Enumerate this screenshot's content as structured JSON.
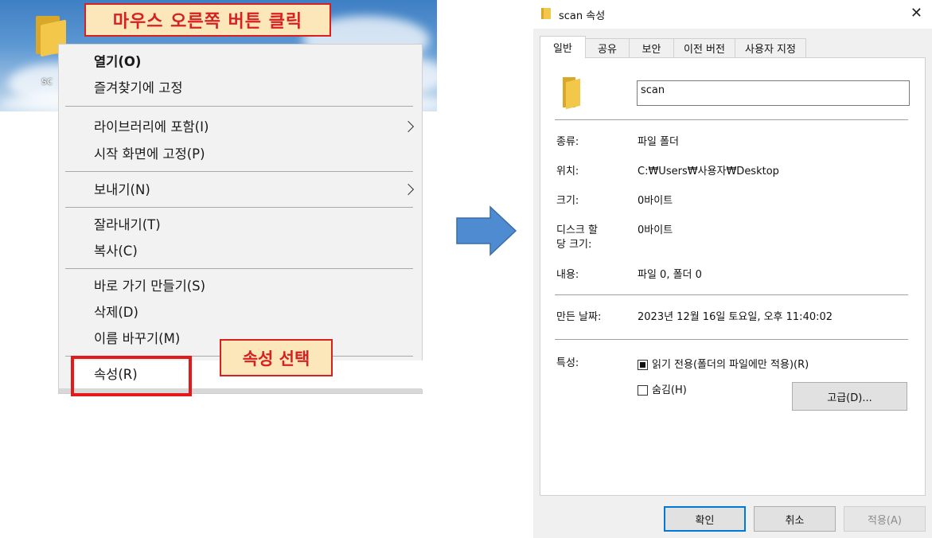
{
  "desktop": {
    "folder_label": "sc"
  },
  "callouts": {
    "right_click": "마우스 오른쪽 버튼 클릭",
    "select_props": "속성 선택"
  },
  "context_menu": {
    "items": [
      {
        "label": "열기(O)"
      },
      {
        "label": "즐겨찾기에 고정"
      },
      {
        "label": "라이브러리에 포함(I)"
      },
      {
        "label": "시작 화면에 고정(P)"
      },
      {
        "label": "보내기(N)"
      },
      {
        "label": "잘라내기(T)"
      },
      {
        "label": "복사(C)"
      },
      {
        "label": "바로 가기 만들기(S)"
      },
      {
        "label": "삭제(D)"
      },
      {
        "label": "이름 바꾸기(M)"
      },
      {
        "label": "속성(R)"
      }
    ]
  },
  "dialog": {
    "title": "scan 속성",
    "close_symbol": "✕",
    "tabs": [
      "일반",
      "공유",
      "보안",
      "이전 버전",
      "사용자 지정"
    ],
    "name_value": "scan",
    "rows": {
      "type_label": "종류:",
      "type_value": "파일 폴더",
      "location_label": "위치:",
      "location_value": "C:₩Users₩사용자₩Desktop",
      "size_label": "크기:",
      "size_value": "0바이트",
      "disk_label_1": "디스크 할",
      "disk_label_2": "당 크기:",
      "disk_value": "0바이트",
      "contents_label": "내용:",
      "contents_value": "파일 0, 폴더 0",
      "created_label": "만든 날짜:",
      "created_value": "2023년 12월 16일 토요일, 오후 11:40:02",
      "attributes_label": "특성:"
    },
    "attributes": {
      "readonly_label": "읽기 전용(폴더의 파일에만 적용)(R)",
      "hidden_label": "숨김(H)",
      "advanced_button": "고급(D)..."
    },
    "buttons": {
      "ok": "확인",
      "cancel": "취소",
      "apply": "적용(A)"
    }
  },
  "colors": {
    "callout_border": "#d92020",
    "callout_fill": "#fbe7ba",
    "arrow": "#4f8bd0",
    "ok_border": "#0078d7"
  }
}
